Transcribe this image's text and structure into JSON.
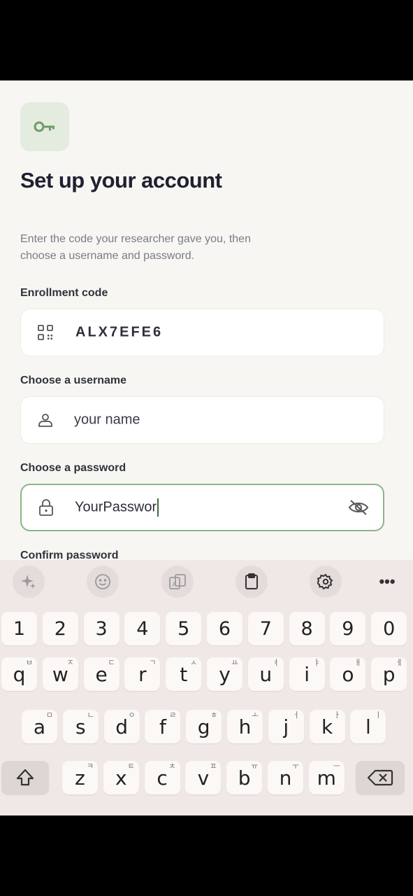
{
  "app": {
    "title": "Set up your account",
    "subtitle": "Enter the code your researcher gave you, then choose a username and password.",
    "fields": {
      "enrollment": {
        "label": "Enrollment code",
        "value": "ALX7EFE6"
      },
      "username": {
        "label": "Choose a username",
        "placeholder": "your name"
      },
      "password": {
        "label": "Choose a password",
        "value": "YourPasswor"
      },
      "confirm": {
        "label": "Confirm password"
      }
    },
    "colors": {
      "accent": "#7faa78",
      "background": "#f7f6f2",
      "badge": "#e4ebdf"
    }
  },
  "keyboard": {
    "toolbar": [
      "sparkle-icon",
      "emoji-icon",
      "translate-icon",
      "clipboard-icon",
      "settings-icon",
      "more-icon"
    ],
    "more_label": "•••",
    "number_row": [
      "1",
      "2",
      "3",
      "4",
      "5",
      "6",
      "7",
      "8",
      "9",
      "0"
    ],
    "row1": [
      {
        "k": "q",
        "s": "ㅂ"
      },
      {
        "k": "w",
        "s": "ㅈ"
      },
      {
        "k": "e",
        "s": "ㄷ"
      },
      {
        "k": "r",
        "s": "ㄱ"
      },
      {
        "k": "t",
        "s": "ㅅ"
      },
      {
        "k": "y",
        "s": "ㅛ"
      },
      {
        "k": "u",
        "s": "ㅕ"
      },
      {
        "k": "i",
        "s": "ㅑ"
      },
      {
        "k": "o",
        "s": "ㅐ"
      },
      {
        "k": "p",
        "s": "ㅔ"
      }
    ],
    "row2": [
      {
        "k": "a",
        "s": "ㅁ"
      },
      {
        "k": "s",
        "s": "ㄴ"
      },
      {
        "k": "d",
        "s": "ㅇ"
      },
      {
        "k": "f",
        "s": "ㄹ"
      },
      {
        "k": "g",
        "s": "ㅎ"
      },
      {
        "k": "h",
        "s": "ㅗ"
      },
      {
        "k": "j",
        "s": "ㅓ"
      },
      {
        "k": "k",
        "s": "ㅏ"
      },
      {
        "k": "l",
        "s": "ㅣ"
      }
    ],
    "row3": [
      {
        "k": "z",
        "s": "ㅋ"
      },
      {
        "k": "x",
        "s": "ㅌ"
      },
      {
        "k": "c",
        "s": "ㅊ"
      },
      {
        "k": "v",
        "s": "ㅍ"
      },
      {
        "k": "b",
        "s": "ㅠ"
      },
      {
        "k": "n",
        "s": "ㅜ"
      },
      {
        "k": "m",
        "s": "ㅡ"
      }
    ]
  }
}
